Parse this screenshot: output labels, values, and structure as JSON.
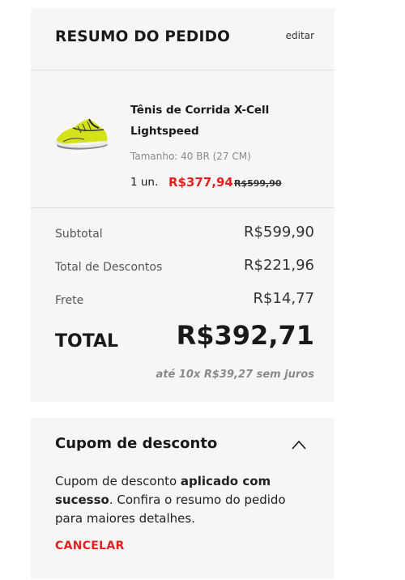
{
  "summary": {
    "title": "RESUMO DO PEDIDO",
    "edit_label": "editar",
    "product": {
      "name": "Tênis de Corrida X-Cell Lightspeed",
      "size": "Tamanho: 40 BR (27 CM)",
      "quantity": "1 un.",
      "price": "R$377,94",
      "old_price": "R$599,90"
    },
    "rows": {
      "subtotal_label": "Subtotal",
      "subtotal_value": "R$599,90",
      "discount_label": "Total de Descontos",
      "discount_value": "R$221,96",
      "shipping_label": "Frete",
      "shipping_value": "R$14,77"
    },
    "total_label": "TOTAL",
    "total_value": "R$392,71",
    "installments": "até 10x R$39,27 sem juros"
  },
  "coupon": {
    "title": "Cupom de desconto",
    "msg_part1": "Cupom de desconto ",
    "msg_bold": "aplicado com sucesso",
    "msg_part2": ". Confira o resumo do pedido para maiores detalhes.",
    "cancel_label": "CANCELAR"
  },
  "colors": {
    "accent_red": "#e52020",
    "card_bg": "#f6f6f6",
    "shoe_upper": "#d4e21a"
  },
  "icons": {
    "coupon_toggle": "chevron-up-icon"
  }
}
